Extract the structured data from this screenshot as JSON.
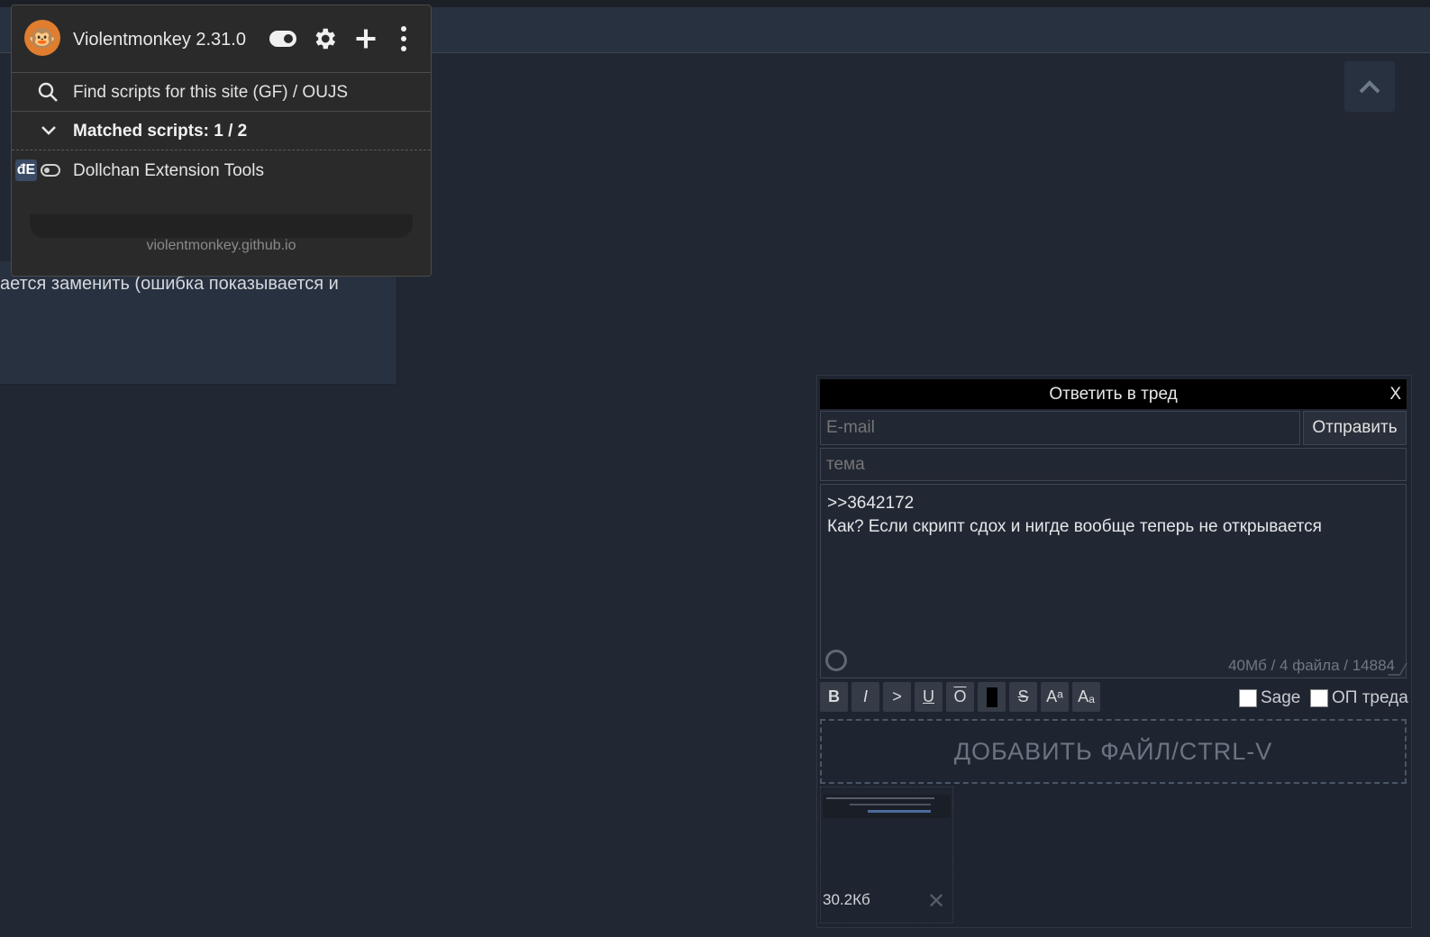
{
  "background_post": {
    "text": "ается заменить (ошибка показывается и"
  },
  "violentmonkey": {
    "title": "Violentmonkey 2.31.0",
    "search_label": "Find scripts for this site (GF)  /  OUJS",
    "matched_label": "Matched scripts: 1 / 2",
    "script_name": "Dollchan Extension Tools",
    "script_icon_text": "đE",
    "footer": "violentmonkey.github.io",
    "icons": [
      "monkey-logo-icon",
      "toggle-icon",
      "gear-icon",
      "plus-icon",
      "more-vertical-icon",
      "search-icon",
      "chevron-down-icon"
    ]
  },
  "reply_form": {
    "title": "Ответить в тред",
    "close_label": "X",
    "email_placeholder": "E-mail",
    "send_label": "Отправить",
    "subject_placeholder": "тема",
    "message_line1": ">>3642172",
    "message_line2": "Как? Если скрипт сдох и нигде вообще теперь не открывается",
    "limits": "40Мб  /  4 файла  /  14884",
    "toolbar": {
      "bold": "B",
      "italic": "I",
      "quote": ">",
      "underline": "U",
      "overline": "O",
      "spoiler": "",
      "strike": "S",
      "sup": "Aᵃ",
      "sub": "Aₐ"
    },
    "sage_label": "Sage",
    "op_label": "ОП треда",
    "dropzone_label": "ДОБАВИТЬ ФАЙЛ/CTRL-V",
    "attachment_size": "30.2Кб",
    "attachment_remove": "✕"
  }
}
